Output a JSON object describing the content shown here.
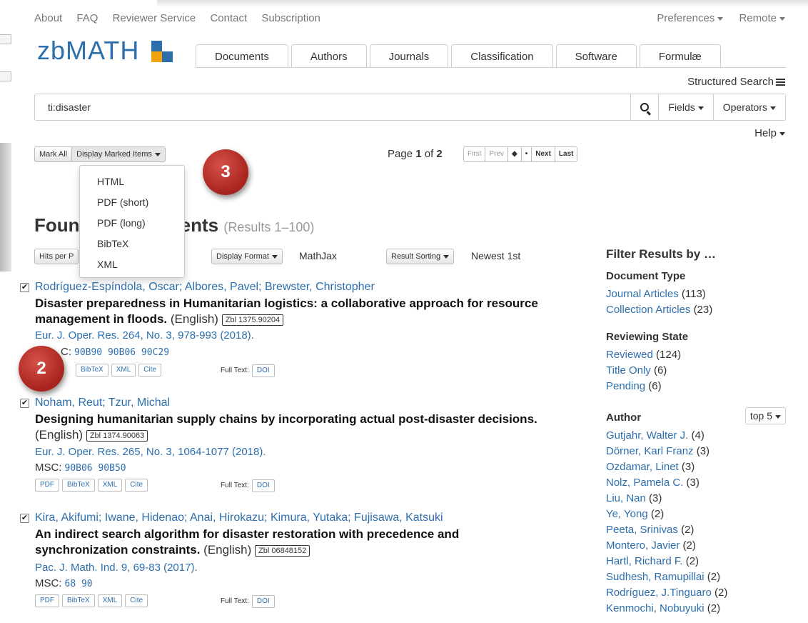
{
  "top_nav": [
    "About",
    "FAQ",
    "Reviewer Service",
    "Contact",
    "Subscription"
  ],
  "top_right": [
    "Preferences",
    "Remote"
  ],
  "logo_text": "zbMATH",
  "tabs": [
    "Documents",
    "Authors",
    "Journals",
    "Classification",
    "Software",
    "Formulæ"
  ],
  "structured_search": "Structured Search",
  "search": {
    "value": "ti:disaster",
    "fields_label": "Fields",
    "operators_label": "Operators"
  },
  "help_label": "Help",
  "toolbar": {
    "mark_all": "Mark All",
    "display_marked": "Display Marked Items"
  },
  "pagination": {
    "prefix": "Page",
    "current": "1",
    "of": "of",
    "total": "2",
    "buttons": [
      "First",
      "Prev",
      "◆",
      "•",
      "Next",
      "Last"
    ]
  },
  "dropdown_items": [
    "HTML",
    "PDF (short)",
    "PDF (long)",
    "BibTeX",
    "XML"
  ],
  "badges": {
    "three": "3",
    "two": "2"
  },
  "found_prefix": "Foun",
  "found_suffix": "ments",
  "found_results": "(Results 1–100)",
  "controls": {
    "hits_per_page": "Hits per P",
    "display_format": "Display Format",
    "format_value": "MathJax",
    "result_sorting": "Result Sorting",
    "sort_value": "Newest 1st"
  },
  "results": [
    {
      "authors": "Rodríguez-Espíndola, Oscar; Albores, Pavel; Brewster, Christopher",
      "title": "Disaster preparedness in Humanitarian logistics: a collaborative approach for resource management in floods.",
      "lang": "(English)",
      "zbl": "Zbl 1375.90204",
      "source": "Eur. J. Oper. Res. 264, No. 3, 978-993 (2018).",
      "msc_label": "C:",
      "msc": "90B90 90B06 90C29",
      "actions": [
        "BibTeX",
        "XML",
        "Cite"
      ],
      "fulltext_label": "Full Text:",
      "fulltext_link": "DOI"
    },
    {
      "authors": "Noham, Reut; Tzur, Michal",
      "title": "Designing humanitarian supply chains by incorporating actual post-disaster decisions.",
      "lang": "(English)",
      "zbl": "Zbl 1374.90063",
      "source": "Eur. J. Oper. Res. 265, No. 3, 1064-1077 (2018).",
      "msc_label": "MSC:",
      "msc": "90B06 90B50",
      "actions": [
        "PDF",
        "BibTeX",
        "XML",
        "Cite"
      ],
      "fulltext_label": "Full Text:",
      "fulltext_link": "DOI"
    },
    {
      "authors": "Kira, Akifumi; Iwane, Hidenao; Anai, Hirokazu; Kimura, Yutaka; Fujisawa, Katsuki",
      "title": "An indirect search algorithm for disaster restoration with precedence and synchronization constraints.",
      "lang": "(English)",
      "zbl": "Zbl 06848152",
      "source": "Pac. J. Math. Ind. 9, 69-83 (2017).",
      "msc_label": "MSC:",
      "msc": "68 90",
      "actions": [
        "PDF",
        "BibTeX",
        "XML",
        "Cite"
      ],
      "fulltext_label": "Full Text:",
      "fulltext_link": "DOI"
    }
  ],
  "sidebar": {
    "title": "Filter Results by …",
    "document_type": {
      "heading": "Document Type",
      "items": [
        {
          "label": "Journal Articles",
          "count": "(113)"
        },
        {
          "label": "Collection Articles",
          "count": "(23)"
        }
      ]
    },
    "reviewing_state": {
      "heading": "Reviewing State",
      "items": [
        {
          "label": "Reviewed",
          "count": "(124)"
        },
        {
          "label": "Title Only",
          "count": "(6)"
        },
        {
          "label": "Pending",
          "count": "(6)"
        }
      ]
    },
    "author": {
      "heading": "Author",
      "top_label": "top 5",
      "items": [
        {
          "label": "Gutjahr, Walter J.",
          "count": "(4)"
        },
        {
          "label": "Dörner, Karl Franz",
          "count": "(3)"
        },
        {
          "label": "Ozdamar, Linet",
          "count": "(3)"
        },
        {
          "label": "Nolz, Pamela C.",
          "count": "(3)"
        },
        {
          "label": "Liu, Nan",
          "count": "(3)"
        },
        {
          "label": "Ye, Yong",
          "count": "(2)"
        },
        {
          "label": "Peeta, Srinivas",
          "count": "(2)"
        },
        {
          "label": "Montero, Javier",
          "count": "(2)"
        },
        {
          "label": "Hartl, Richard F.",
          "count": "(2)"
        },
        {
          "label": "Sudhesh, Ramupillai",
          "count": "(2)"
        },
        {
          "label": "Rodríguez, J.Tinguaro",
          "count": "(2)"
        },
        {
          "label": "Kenmochi, Nobuyuki",
          "count": "(2)"
        }
      ]
    }
  },
  "colors": {
    "link": "#2d6fad",
    "logo_orange": "#f0a30a",
    "badge_red": "#b8322b"
  }
}
